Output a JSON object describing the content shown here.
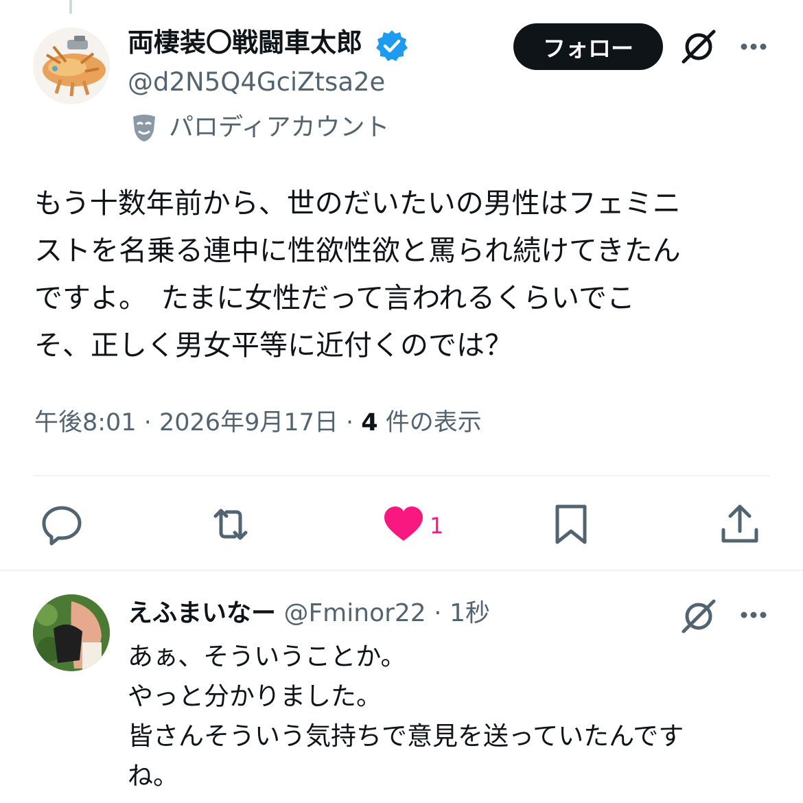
{
  "tweet": {
    "author": {
      "display_name": "両棲装〇戦闘車太郎",
      "handle": "@d2N5Q4GciZtsa2e",
      "verified": true,
      "label": "パロディアカウント",
      "label_icon": "parody-mask-icon"
    },
    "follow_label": "フォロー",
    "text": "もう十数年前から、世のだいたいの男性はフェミニ\nストを名乗る連中に性欲性欲と罵られ続けてきたん\nですよ。　たまに女性だって言われるくらいでこ\nそ、正しく男女平等に近付くのでは？",
    "time": "午後8:01",
    "date": "2026年9月17日",
    "views_count": "4",
    "views_label": "件の表示",
    "like_count": "1"
  },
  "reply": {
    "display_name": "えふまいなー",
    "handle": "@Fminor22",
    "time": "1秒",
    "text": "あぁ、そういうことか。\nやっと分かりました。\n皆さんそういう気持ちで意見を送っていたんです\nね。"
  },
  "colors": {
    "accent_blue": "#1d9bf0",
    "like_pink": "#f91880",
    "text_primary": "#0f1419",
    "text_secondary": "#536471",
    "follow_bg": "#0f1419",
    "divider": "#eff3f4"
  },
  "icons": [
    "verified-badge-icon",
    "parody-mask-icon",
    "grok-icon",
    "more-icon",
    "reply-icon",
    "repost-icon",
    "heart-icon",
    "bookmark-icon",
    "share-icon"
  ]
}
